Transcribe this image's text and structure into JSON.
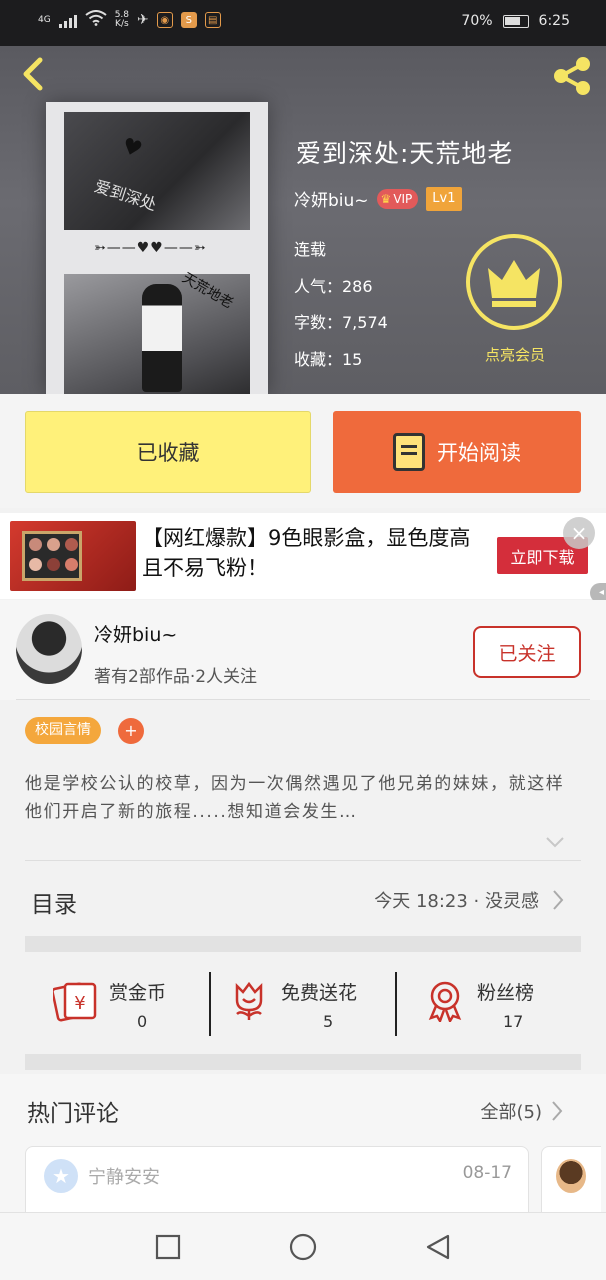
{
  "status_bar": {
    "network": "4G",
    "speed_value": "5.8",
    "speed_unit": "K/s",
    "battery": "70%",
    "time": "6:25"
  },
  "book": {
    "title": "爱到深处:天荒地老",
    "cover_text_top": "爱到深处",
    "cover_text_bottom": "天荒地老",
    "cover_arrow": "➳——♥♥——➳",
    "author": "冷妍biu~",
    "vip_label": "VIP",
    "level_label": "Lv1",
    "status": "连载",
    "popularity": "人气：286",
    "word_count": "字数：7,574",
    "favorites": "收藏：15",
    "member_label": "点亮会员"
  },
  "buttons": {
    "favorited": "已收藏",
    "start_reading": "开始阅读"
  },
  "ad": {
    "text": "【网红爆款】9色眼影盒，显色度高且不易飞粉！",
    "cta": "立即下载",
    "close": "×"
  },
  "author_card": {
    "name": "冷妍biu~",
    "subtitle": "著有2部作品·2人关注",
    "follow_label": "已关注"
  },
  "tags": {
    "genre": "校园言情",
    "add": "+"
  },
  "description": "他是学校公认的校草，因为一次偶然遇见了他兄弟的妹妹，就这样他们开启了新的旅程.....想知道会发生…",
  "catalog": {
    "label": "目录",
    "update": "今天 18:23 · 没灵感"
  },
  "actions": [
    {
      "label": "赏金币",
      "count": "0"
    },
    {
      "label": "免费送花",
      "count": "5"
    },
    {
      "label": "粉丝榜",
      "count": "17"
    }
  ],
  "comments": {
    "label": "热门评论",
    "all": "全部(5)",
    "first": {
      "user": "宁静安安",
      "date": "08-17"
    }
  },
  "colors": {
    "accent_orange": "#ef6a3c",
    "fav_yellow": "#fff17a",
    "member_yellow": "#f5e463",
    "follow_red": "#c8322a"
  }
}
